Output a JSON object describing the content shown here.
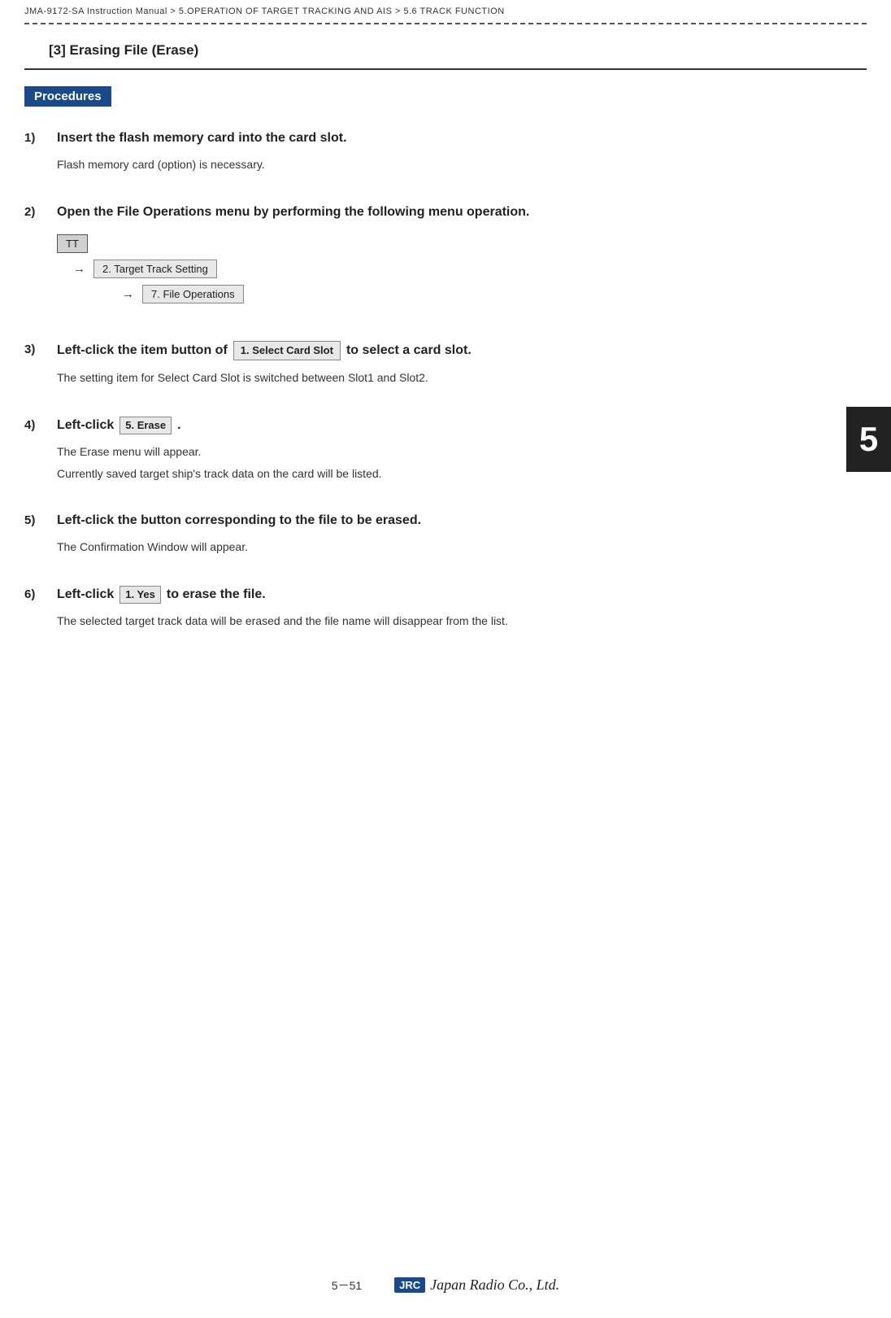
{
  "breadcrumb": {
    "text": "JMA-9172-SA Instruction Manual  >  5.OPERATION OF TARGET TRACKING AND AIS  >  5.6  TRACK FUNCTION"
  },
  "section": {
    "title": "[3]  Erasing File  (Erase)"
  },
  "procedures_badge": "Procedures",
  "chapter_number": "5",
  "steps": [
    {
      "number": "1)",
      "heading": "Insert the flash memory card into the card slot.",
      "desc": "Flash memory card (option) is necessary.",
      "type": "simple"
    },
    {
      "number": "2)",
      "heading": "Open the File Operations menu by performing the following menu operation.",
      "type": "menu",
      "menu": {
        "top_button": "TT",
        "row1_arrow": "→",
        "row1_label": "2. Target Track Setting",
        "row2_arrow": "→",
        "row2_label": "7. File Operations"
      }
    },
    {
      "number": "3)",
      "heading_pre": "Left-click the item button of",
      "button_label": "1. Select Card Slot",
      "heading_post": "to select a card slot.",
      "desc": "The setting item for Select Card Slot is switched between Slot1 and Slot2.",
      "type": "button_inline"
    },
    {
      "number": "4)",
      "heading_pre": "Left-click",
      "button_label": "5. Erase",
      "heading_post": ".",
      "desc1": "The Erase menu will appear.",
      "desc2": "Currently saved target ship's track data on the card will be listed.",
      "type": "button_inline2"
    },
    {
      "number": "5)",
      "heading": "Left-click the button corresponding to the file to be erased.",
      "desc": "The Confirmation Window will appear.",
      "type": "simple"
    },
    {
      "number": "6)",
      "heading_pre": "Left-click",
      "button_label": "1. Yes",
      "heading_post": "to erase the file.",
      "desc": "The selected target track data will be erased and the file name will disappear from the list.",
      "type": "button_inline3"
    }
  ],
  "footer": {
    "page": "5－51",
    "jrc_label": "JRC",
    "brand": "Japan Radio Co., Ltd."
  }
}
